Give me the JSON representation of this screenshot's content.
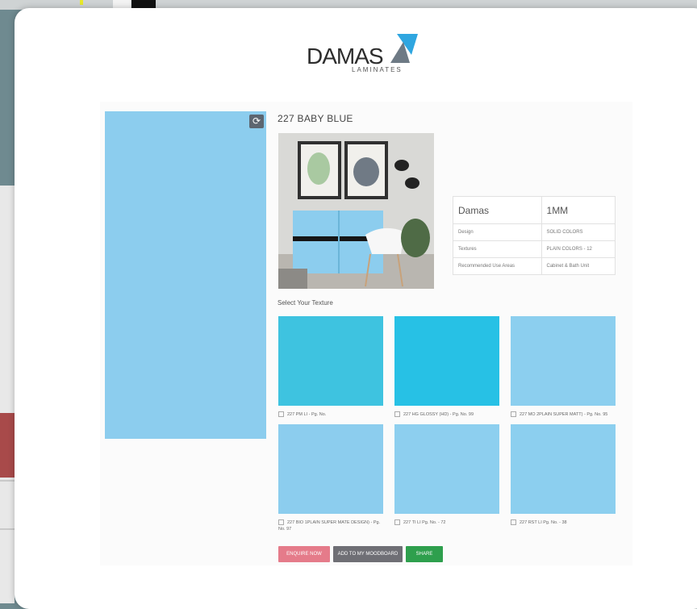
{
  "brand": {
    "name": "DAMAS",
    "subtitle": "LAMINATES"
  },
  "product": {
    "title": "227 BABY BLUE",
    "swatch_color": "#8ccdee"
  },
  "specs": {
    "brand": "Damas",
    "thickness": "1MM",
    "rows": [
      {
        "label": "Design",
        "value": "SOLID COLORS"
      },
      {
        "label": "Textures",
        "value": "PLAIN COLORS - 12"
      },
      {
        "label": "Recommended Use Areas",
        "value": "Cabinet & Bath Unit"
      }
    ]
  },
  "texture_section_label": "Select Your Texture",
  "textures": [
    {
      "caption": "227 PM LI - Pg. No.",
      "color": "#3ec3e0"
    },
    {
      "caption": "227 HG GLOSSY (HD) - Pg. No. 99",
      "color": "#27c1e5"
    },
    {
      "caption": "227 MO 2PLAIN SUPER MATT) - Pg. No. 95",
      "color": "#8ccfef"
    },
    {
      "caption": "227 BIO 1PLAIN SUPER MATE DESIGN) - Pg. No. 97",
      "color": "#8ccdee"
    },
    {
      "caption": "227 TI LI Pg. No. - 72",
      "color": "#8dcfef"
    },
    {
      "caption": "227 RST LI Pg. No. - 38",
      "color": "#8ccfef"
    }
  ],
  "buttons": {
    "enquire": "ENQUIRE NOW",
    "moodboard": "ADD TO MY MOODBOARD",
    "share": "SHARE"
  },
  "colors": {
    "enquire": "#e57b8a",
    "moodboard": "#6f6f75",
    "share": "#2e9f4d",
    "logo_accent": "#2fa6e0"
  }
}
